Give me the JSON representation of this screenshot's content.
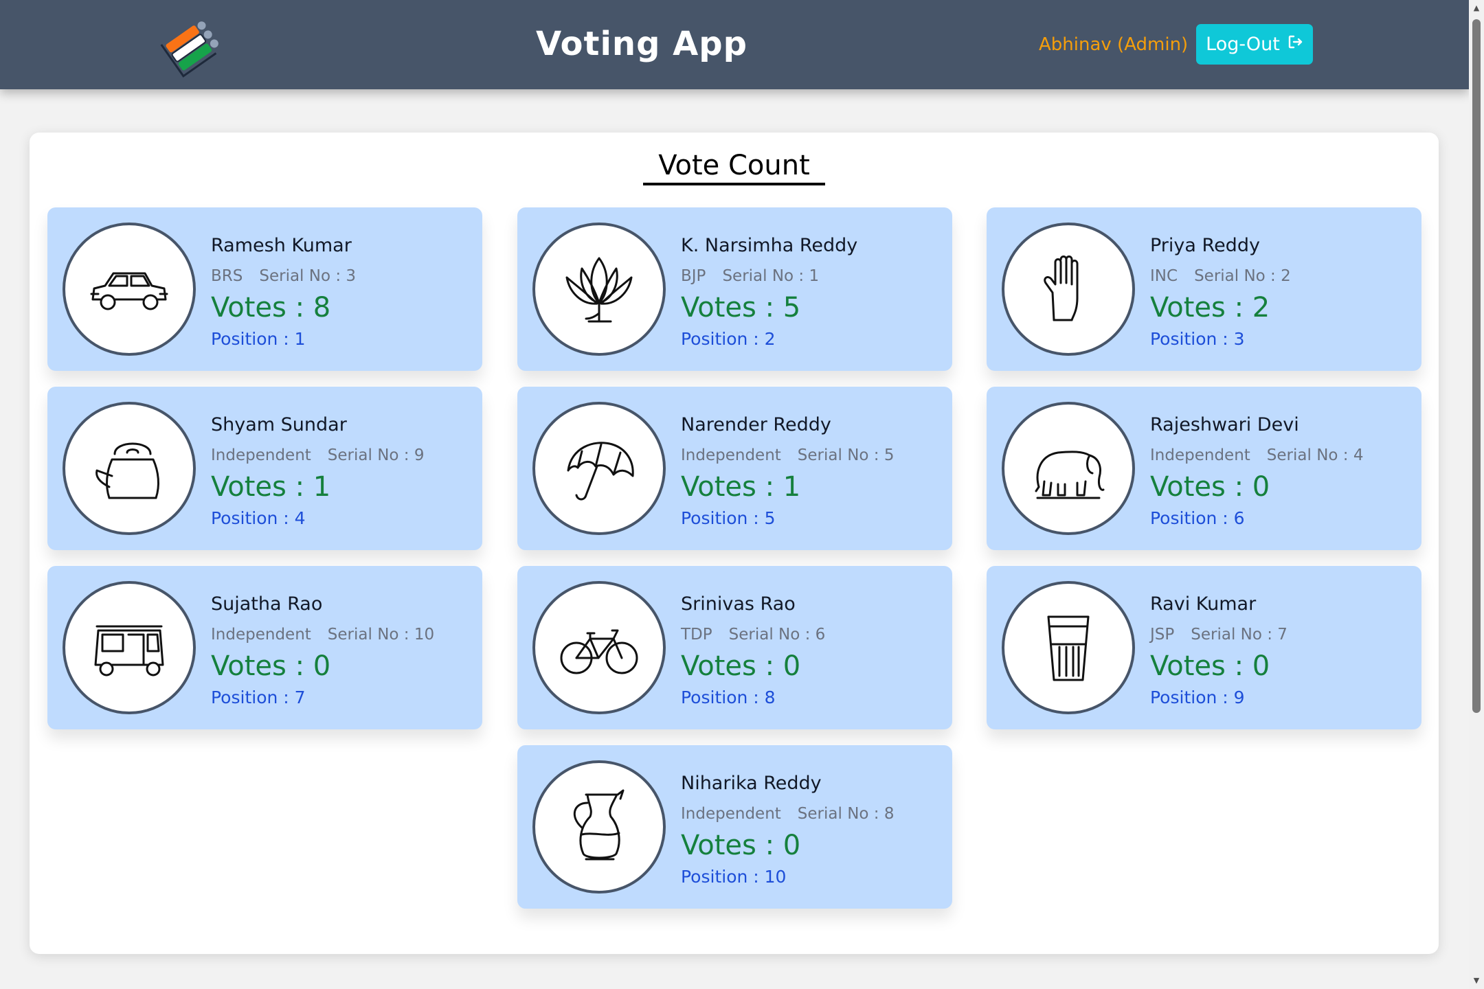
{
  "header": {
    "title": "Voting App",
    "user": "Abhinav (Admin)",
    "logout_label": "Log-Out"
  },
  "main": {
    "title": "Vote Count",
    "candidates": [
      {
        "name": "Ramesh Kumar",
        "party": "BRS",
        "serial": "Serial No : 3",
        "votes": "Votes : 8",
        "position": "Position : 1",
        "symbol": "car-icon"
      },
      {
        "name": "K. Narsimha Reddy",
        "party": "BJP",
        "serial": "Serial No : 1",
        "votes": "Votes : 5",
        "position": "Position : 2",
        "symbol": "lotus-icon"
      },
      {
        "name": "Priya Reddy",
        "party": "INC",
        "serial": "Serial No : 2",
        "votes": "Votes : 2",
        "position": "Position : 3",
        "symbol": "hand-icon"
      },
      {
        "name": "Shyam Sundar",
        "party": "Independent",
        "serial": "Serial No : 9",
        "votes": "Votes : 1",
        "position": "Position : 4",
        "symbol": "kettle-icon"
      },
      {
        "name": "Narender Reddy",
        "party": "Independent",
        "serial": "Serial No : 5",
        "votes": "Votes : 1",
        "position": "Position : 5",
        "symbol": "umbrella-icon"
      },
      {
        "name": "Rajeshwari Devi",
        "party": "Independent",
        "serial": "Serial No : 4",
        "votes": "Votes : 0",
        "position": "Position : 6",
        "symbol": "elephant-icon"
      },
      {
        "name": "Sujatha Rao",
        "party": "Independent",
        "serial": "Serial No : 10",
        "votes": "Votes : 0",
        "position": "Position : 7",
        "symbol": "auto-rickshaw-icon"
      },
      {
        "name": "Srinivas Rao",
        "party": "TDP",
        "serial": "Serial No : 6",
        "votes": "Votes : 0",
        "position": "Position : 8",
        "symbol": "bicycle-icon"
      },
      {
        "name": "Ravi Kumar",
        "party": "JSP",
        "serial": "Serial No : 7",
        "votes": "Votes : 0",
        "position": "Position : 9",
        "symbol": "glass-icon"
      },
      {
        "name": "Niharika Reddy",
        "party": "Independent",
        "serial": "Serial No : 8",
        "votes": "Votes : 0",
        "position": "Position : 10",
        "symbol": "jug-icon"
      }
    ]
  },
  "colors": {
    "header_bg": "#475569",
    "accent": "#0fc8d8",
    "user_label": "#f59e0b",
    "card_bg": "#bfdbfe",
    "votes": "#15803d",
    "position": "#1d4ed8"
  }
}
